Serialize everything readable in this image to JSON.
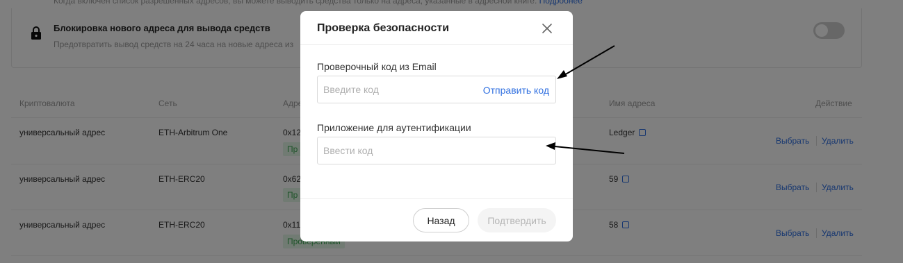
{
  "background": {
    "top_note": "Когда включен список разрешенных адресов, вы можете выводить средства только на адреса, указанные в адресной книге.",
    "top_note_link": "Подробнее",
    "setting": {
      "title": "Блокировка нового адреса для вывода средств",
      "description": "Предотвратить вывод средств на 24 часа на новые адреса из",
      "toggle_on": false
    },
    "table": {
      "headers": {
        "currency": "Криптовалюта",
        "network": "Сеть",
        "address": "Адре",
        "name": "Имя адреса",
        "action": "Действие"
      },
      "rows": [
        {
          "currency": "универсальный адрес",
          "network": "ETH-Arbitrum One",
          "address": "0x12",
          "badge": "Пр",
          "name": "Ledger",
          "select": "Выбрать",
          "delete": "Удалить"
        },
        {
          "currency": "универсальный адрес",
          "network": "ETH-ERC20",
          "address": "0x62",
          "badge": "Пр",
          "name": "59",
          "select": "Выбрать",
          "delete": "Удалить"
        },
        {
          "currency": "универсальный адрес",
          "network": "ETH-ERC20",
          "address": "0x11",
          "badge": "Проверенный",
          "name": "58",
          "select": "Выбрать",
          "delete": "Удалить"
        }
      ]
    }
  },
  "modal": {
    "title": "Проверка безопасности",
    "email_label": "Проверочный код из Email",
    "email_placeholder": "Введите код",
    "send_code": "Отправить код",
    "auth_label": "Приложение для аутентификации",
    "auth_placeholder": "Ввести код",
    "back_button": "Назад",
    "confirm_button": "Подтвердить"
  },
  "colors": {
    "accent": "#2f6fe0",
    "overlay": "rgba(0,0,0,0.5)",
    "badge_bg": "#e3f6e6",
    "badge_text": "#3aa651"
  }
}
